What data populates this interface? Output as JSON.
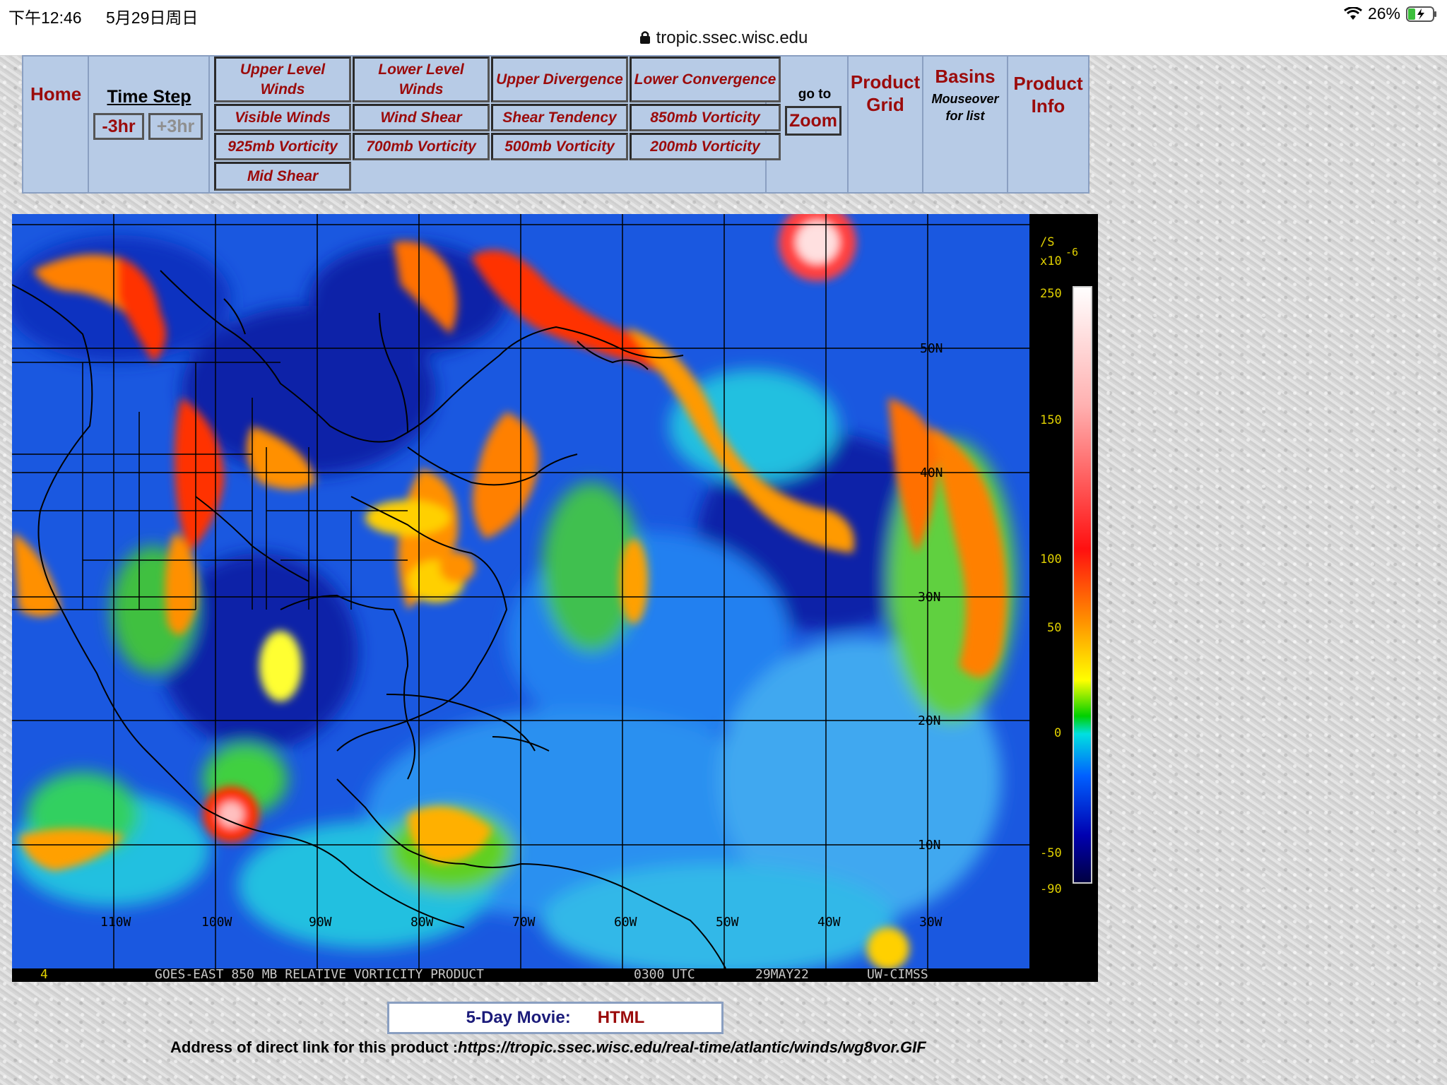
{
  "status": {
    "time": "下午12:46",
    "date": "5月29日周日",
    "battery": "26%",
    "url": "tropic.ssec.wisc.edu"
  },
  "nav": {
    "home": "Home",
    "time_step": "Time Step",
    "minus": "-3hr",
    "plus": "+3hr",
    "products": [
      "Upper Level Winds",
      "Lower Level Winds",
      "Upper Divergence",
      "Lower Convergence",
      "Visible Winds",
      "Wind Shear",
      "Shear Tendency",
      "850mb Vorticity",
      "925mb Vorticity",
      "700mb Vorticity",
      "500mb Vorticity",
      "200mb Vorticity",
      "Mid Shear"
    ],
    "goto": "go to",
    "zoom": "Zoom",
    "product_grid": "Product Grid",
    "basins": "Basins",
    "basins_sub": "Mouseover for list",
    "product_info": "Product Info"
  },
  "map": {
    "units": "/S",
    "scale_prefix": "x10",
    "scale_exp": "-6",
    "scale_ticks": [
      "250",
      "150",
      "100",
      "50",
      "0",
      "-50",
      "-90"
    ],
    "lat_labels": [
      "50N",
      "40N",
      "30N",
      "20N",
      "10N"
    ],
    "lon_labels": [
      "110W",
      "100W",
      "90W",
      "80W",
      "70W",
      "60W",
      "50W",
      "40W",
      "30W"
    ],
    "footer_frame": "4",
    "footer_product": "GOES-EAST 850 MB RELATIVE VORTICITY PRODUCT",
    "footer_time": "0300 UTC",
    "footer_date": "29MAY22",
    "footer_source": "UW-CIMSS"
  },
  "movie": {
    "label": "5-Day Movie:",
    "html": "HTML"
  },
  "link": {
    "label": "Address of direct link for this product :",
    "url": "https://tropic.ssec.wisc.edu/real-time/atlantic/winds/wg8vor.GIF"
  },
  "colors": {
    "nav_bg": "#b7cbe6",
    "link_red": "#9b0b0b",
    "map_bg": "#000000",
    "label_yellow": "#e0d000"
  }
}
